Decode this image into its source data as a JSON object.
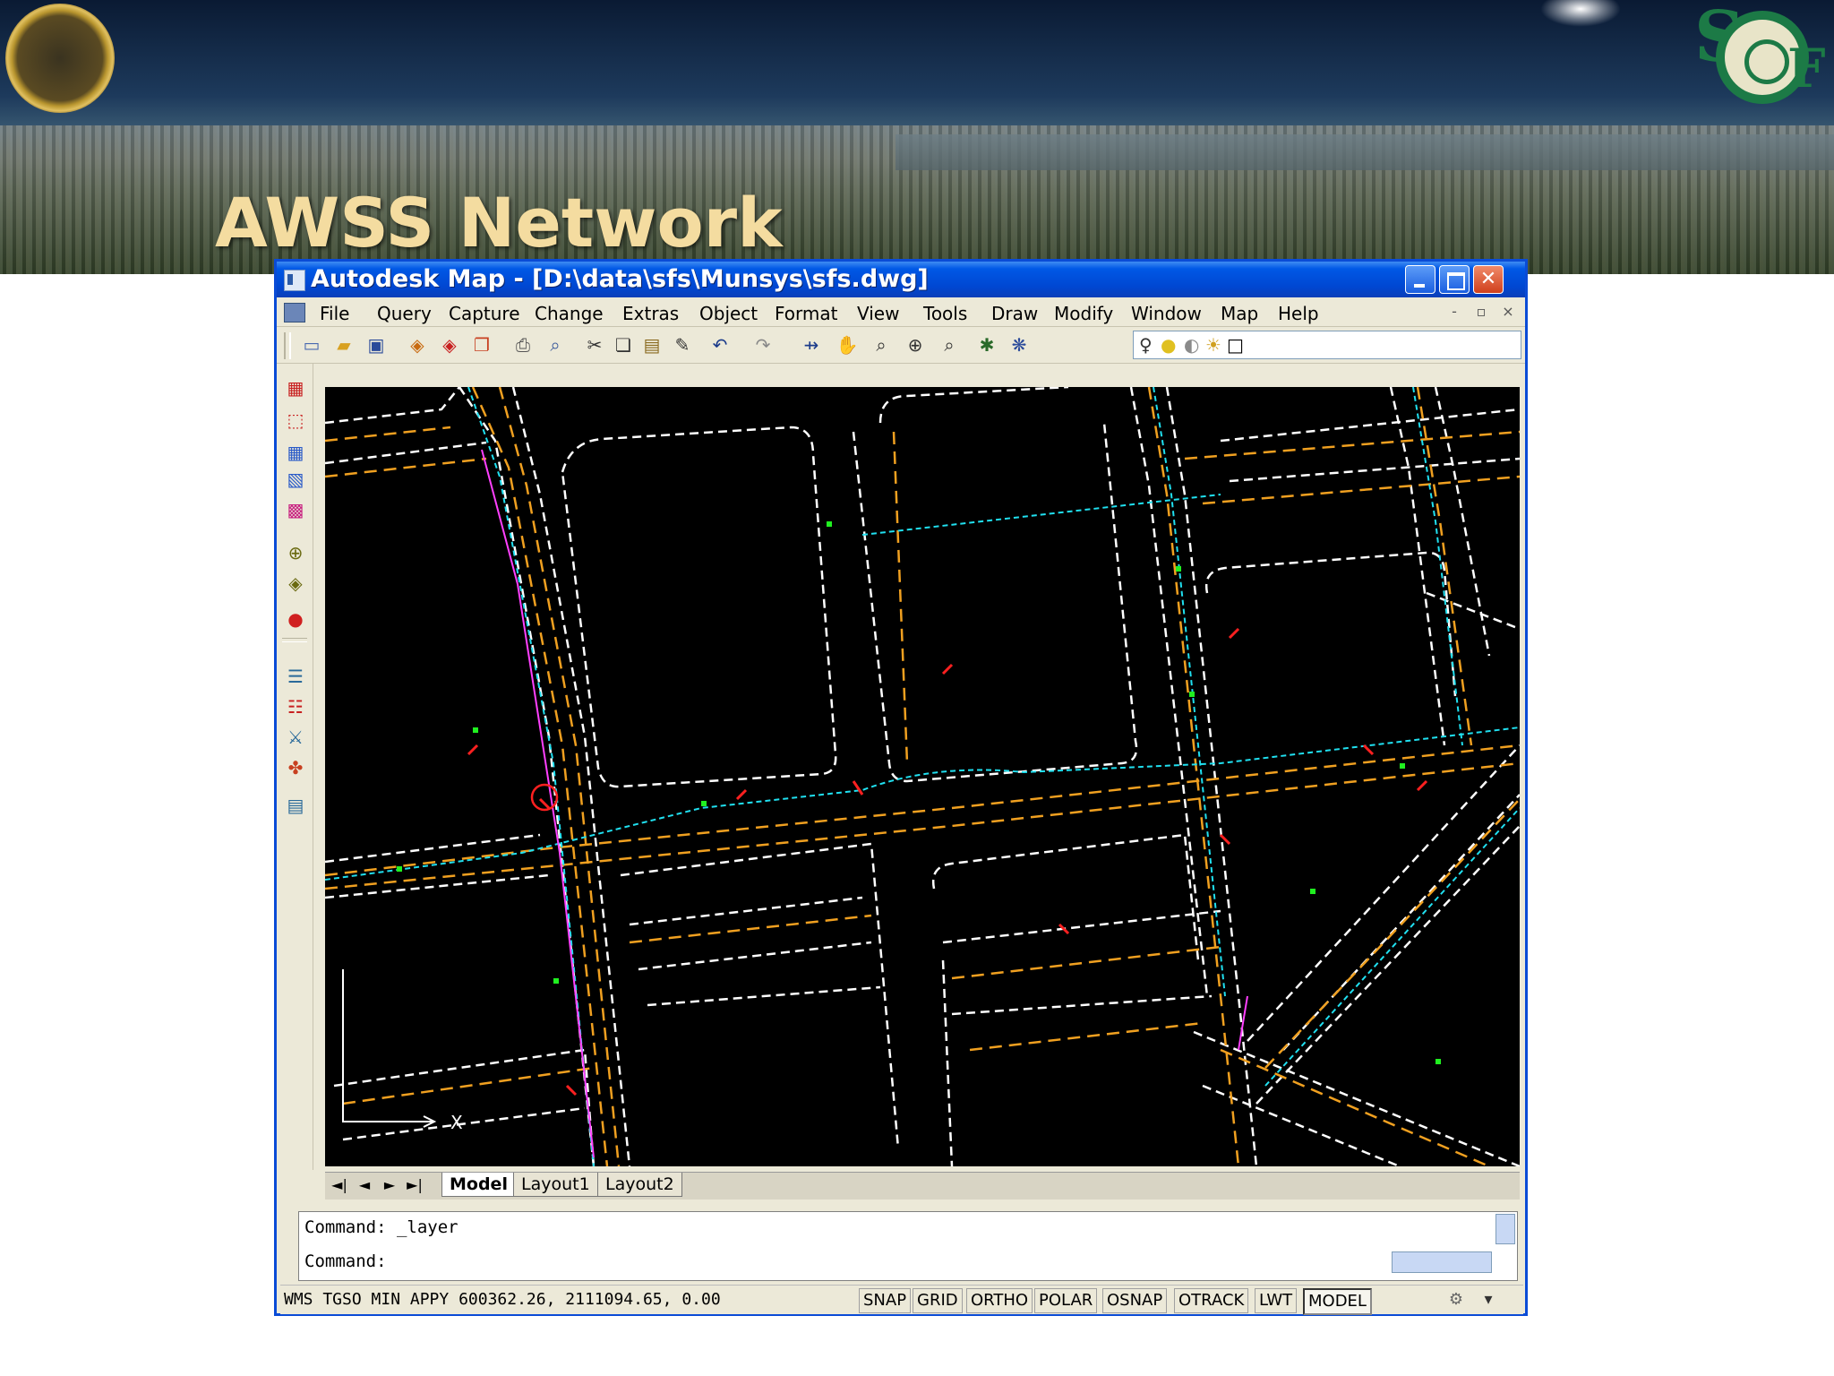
{
  "slide": {
    "title": "AWSS Network"
  },
  "window": {
    "title": "Autodesk Map - [D:\\data\\sfs\\Munsys\\sfs.dwg]",
    "controls": {
      "minimize": "minimize-icon",
      "maximize": "maximize-icon",
      "close": "✕"
    }
  },
  "menu": {
    "items": [
      "File",
      "Query",
      "Capture",
      "Change",
      "Extras",
      "Object",
      "Format",
      "View",
      "Tools",
      "Draw",
      "Modify",
      "Window",
      "Map",
      "Help"
    ],
    "mdi_controls": [
      "-",
      "▫",
      "×"
    ]
  },
  "layout_tabs": {
    "nav": [
      "◄|",
      "◄",
      "►",
      "►|"
    ],
    "tabs": [
      "Model",
      "Layout1",
      "Layout2"
    ],
    "active": "Model"
  },
  "command": {
    "line1": "Command:  _layer",
    "line2": "Command:"
  },
  "status": {
    "coords": "WMS TGSO MIN APPY  600362.26, 2111094.65, 0.00",
    "buttons": [
      {
        "label": "SNAP",
        "on": false
      },
      {
        "label": "GRID",
        "on": false
      },
      {
        "label": "ORTHO",
        "on": false
      },
      {
        "label": "POLAR",
        "on": false
      },
      {
        "label": "OSNAP",
        "on": false
      },
      {
        "label": "OTRACK",
        "on": false
      },
      {
        "label": "LWT",
        "on": false
      },
      {
        "label": "MODEL",
        "on": true
      }
    ]
  },
  "colors": {
    "canvas": "#000000",
    "streets": "#ffffff",
    "curbs": "#f0a020",
    "water_main": "#20e0f0",
    "valves": "#20f020",
    "hydrants": "#ff2020",
    "services": "#ff40ff",
    "title_bar": "#0047d2",
    "slide_title": "#f4dca0"
  },
  "icons": {
    "toolbar": [
      "new-icon",
      "open-icon",
      "save-icon",
      "plot-icon",
      "plot-preview-icon",
      "publish-icon",
      "print-icon",
      "find-icon",
      "cut-icon",
      "copy-icon",
      "paste-icon",
      "match-properties-icon",
      "undo-icon",
      "redo-icon",
      "pan-icon",
      "zoom-realtime-icon",
      "zoom-window-icon",
      "zoom-previous-icon",
      "zoom-extents-icon",
      "properties-icon",
      "design-center-icon"
    ],
    "left_toolbar": [
      "query-icon",
      "select-icon",
      "define-icon",
      "attach-icon",
      "layer-icon",
      "locate-icon",
      "target-icon",
      "info-icon",
      "table-icon",
      "link-icon",
      "map-icon",
      "topology-icon",
      "export-icon"
    ]
  }
}
